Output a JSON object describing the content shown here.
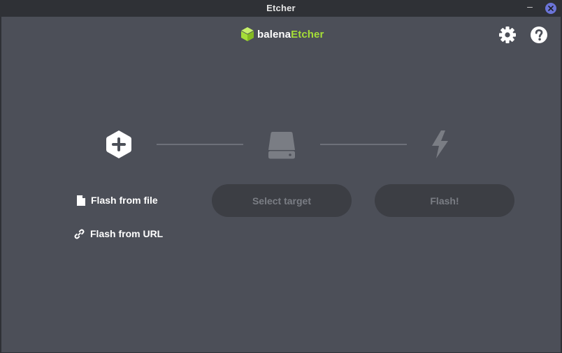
{
  "window": {
    "title": "Etcher"
  },
  "brand": {
    "prefix": "balena",
    "suffix": "Etcher",
    "accent_color": "#a5de37"
  },
  "toolbar": {
    "settings_icon": "gear-icon",
    "help_icon": "help-icon"
  },
  "steps": {
    "source": {
      "icon": "plus-hexagon-icon",
      "flash_from_file": "Flash from file",
      "flash_from_url": "Flash from URL"
    },
    "target": {
      "icon": "drive-icon",
      "button_label": "Select target"
    },
    "flash": {
      "icon": "lightning-icon",
      "button_label": "Flash!"
    }
  },
  "colors": {
    "background": "#4c4f58",
    "titlebar": "#2f3136",
    "disabled_button": "#3c3e44",
    "disabled_text": "#7a7d84"
  }
}
